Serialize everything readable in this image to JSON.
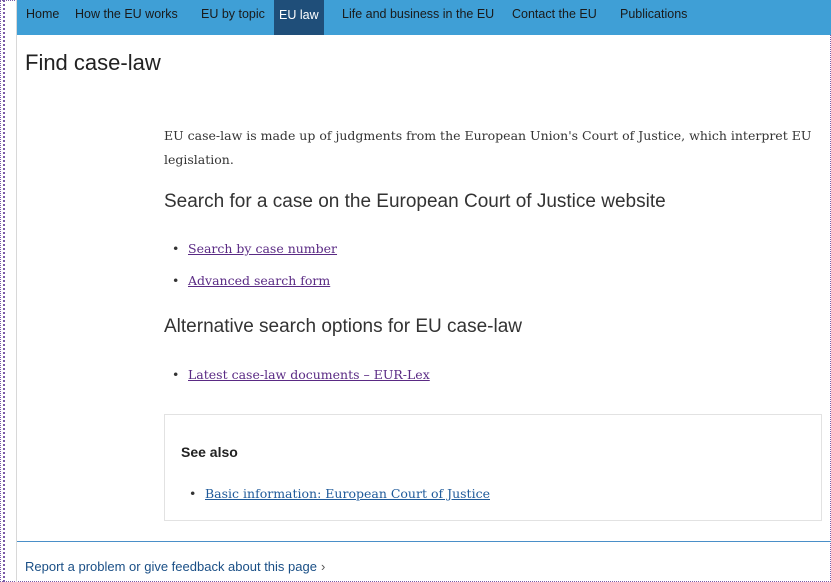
{
  "nav": {
    "items": [
      {
        "label": "Home",
        "active": false
      },
      {
        "label": "How the EU works",
        "active": false
      },
      {
        "label": "EU by topic",
        "active": false
      },
      {
        "label": "EU law",
        "active": true
      },
      {
        "label": "Life and business in the EU",
        "active": false
      },
      {
        "label": "Contact the EU",
        "active": false
      },
      {
        "label": "Publications",
        "active": false
      }
    ]
  },
  "page": {
    "title": "Find case-law",
    "intro": "EU case-law is made up of judgments from the European Union's Court of Justice, which interpret EU legislation."
  },
  "sections": [
    {
      "heading": "Search for a case on the European Court of Justice website",
      "links": [
        "Search by case number",
        "Advanced search form"
      ]
    },
    {
      "heading": "Alternative search options for EU case-law",
      "links": [
        "Latest case-law documents – EUR-Lex"
      ]
    }
  ],
  "see_also": {
    "heading": "See also",
    "links": [
      "Basic information: European Court of Justice"
    ]
  },
  "footer": {
    "feedback_label": "Report a problem or give feedback about this page",
    "chevron": "›"
  },
  "colors": {
    "nav_bg": "#3f9fd6",
    "nav_active_bg": "#1f4e79",
    "visited_link": "#5a2a84",
    "link": "#1f5a9a"
  }
}
